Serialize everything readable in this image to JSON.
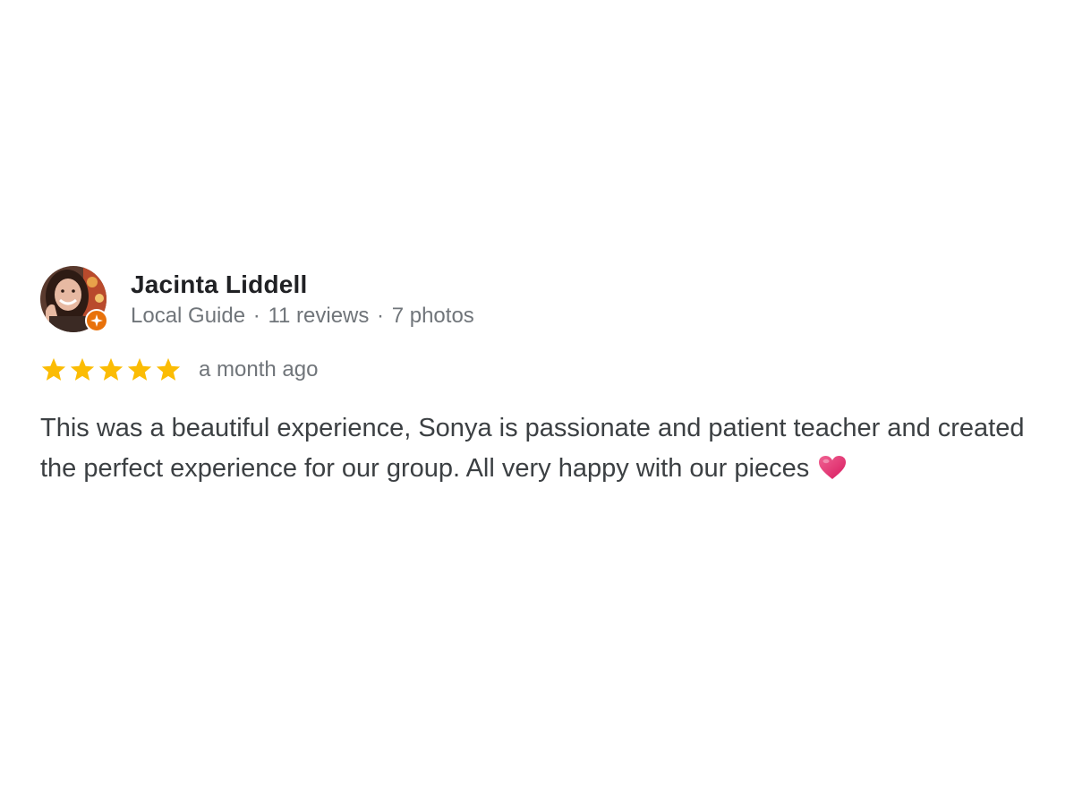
{
  "reviewer": {
    "name": "Jacinta Liddell",
    "badge": "Local Guide",
    "reviews": "11 reviews",
    "photos": "7 photos",
    "separator": "·",
    "avatar_icon": "reviewer-photo",
    "badge_icon": "local-guide-star-icon"
  },
  "rating": {
    "stars": 5,
    "max_stars": 5,
    "star_color": "#fbbc04",
    "time": "a month ago"
  },
  "review": {
    "text": "This was a beautiful experience, Sonya is passionate and patient teacher and created the perfect experience for our group. All very happy with our pieces",
    "emoji_icon": "heart-icon",
    "emoji_color": "#e8336d"
  },
  "colors": {
    "name": "#202124",
    "meta": "#70757a",
    "body": "#3c4043",
    "badge": "#e8710a"
  }
}
